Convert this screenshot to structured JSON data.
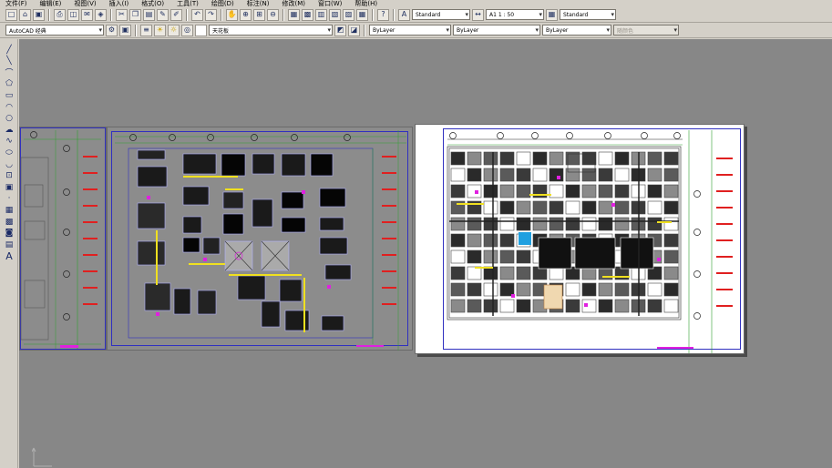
{
  "menu": {
    "items": [
      "文件(F)",
      "编辑(E)",
      "视图(V)",
      "插入(I)",
      "格式(O)",
      "工具(T)",
      "绘图(D)",
      "标注(N)",
      "修改(M)",
      "窗口(W)",
      "帮助(H)"
    ]
  },
  "toolbar1": {
    "text_style_combo": "Standard",
    "dim_style_combo": "A1 1 : 50",
    "table_style_combo": "Standard"
  },
  "toolbar2": {
    "workspace_combo": "AutoCAD 经典",
    "layer_combo": "天花板",
    "color_combo": "ByLayer",
    "linetype_combo": "ByLayer",
    "lineweight_combo": "ByLayer",
    "plotstyle_combo": "随颜色"
  },
  "palette": {
    "icons": [
      "line-icon",
      "construction-line-icon",
      "polyline-icon",
      "polygon-icon",
      "rectangle-icon",
      "arc-icon",
      "circle-icon",
      "revision-cloud-icon",
      "spline-icon",
      "ellipse-icon",
      "ellipse-arc-icon",
      "insert-block-icon",
      "make-block-icon",
      "point-icon",
      "hatch-icon",
      "gradient-icon",
      "region-icon",
      "table-icon",
      "multiline-text-icon"
    ],
    "text_tool_label": "A"
  },
  "colors": {
    "canvas_bg": "#878787",
    "frame_blue": "#3030c0",
    "grid_green": "#30a030",
    "accent_red": "#e02020",
    "accent_magenta": "#e020e0",
    "accent_yellow": "#f0e020"
  }
}
